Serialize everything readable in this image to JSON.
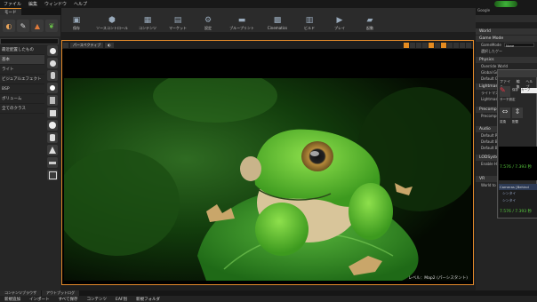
{
  "menu": {
    "items": [
      "ファイル",
      "編集",
      "ウィンドウ",
      "ヘルプ"
    ]
  },
  "tab": {
    "title": "モード"
  },
  "right_top": {
    "label": "Google"
  },
  "left_panel": {
    "categories": [
      "最近配置したもの",
      "基本",
      "ライト",
      "ビジュアルエフェクト",
      "BSP",
      "ボリューム",
      "全てのクラス"
    ],
    "mode_icons": [
      "place-mode-icon",
      "paint-mode-icon",
      "landscape-mode-icon",
      "foliage-mode-icon"
    ]
  },
  "toolbar": {
    "buttons": [
      {
        "label": "保存",
        "icon": "save-icon"
      },
      {
        "label": "ソースコントロール",
        "icon": "source-control-icon"
      },
      {
        "label": "コンテンツ",
        "icon": "content-icon"
      },
      {
        "label": "マーケット",
        "icon": "marketplace-icon"
      },
      {
        "label": "設定",
        "icon": "settings-icon"
      },
      {
        "label": "ブループリント",
        "icon": "blueprint-icon"
      },
      {
        "label": "Cinematics",
        "icon": "cinematics-icon"
      },
      {
        "label": "ビルド",
        "icon": "build-icon"
      },
      {
        "label": "プレイ",
        "icon": "play-icon"
      },
      {
        "label": "起動",
        "icon": "launch-icon"
      }
    ]
  },
  "viewport": {
    "tab": "ビューポート 1",
    "perspective": "パースペクティブ",
    "caption": "レベル：Map2 (パーシスタント)"
  },
  "details": {
    "sections": [
      {
        "title": "World",
        "rows": []
      },
      {
        "title": "Game Mode",
        "rows": [
          "GameMode",
          "選択したゲー"
        ]
      },
      {
        "title": "Physics",
        "rows": [
          "Override World",
          "Global Gravity",
          "Default Gravity"
        ]
      },
      {
        "title": "Lightmass",
        "rows": [
          "ライトマス",
          "Lightmass"
        ]
      },
      {
        "title": "Precomputed",
        "rows": [
          "Precomputed"
        ]
      },
      {
        "title": "Audio",
        "rows": [
          "Default Re",
          "Default Ba",
          "Default Ba"
        ]
      },
      {
        "title": "LODSystem",
        "rows": [
          "Enable HI"
        ]
      },
      {
        "title": "VR",
        "rows": [
          "World to"
        ]
      }
    ],
    "game_mode_value": "None",
    "stats_value_1": "7.576 / 7.393 秒",
    "stats_value_2": "7.576 / 7.393 秒"
  },
  "overlay": {
    "menu": [
      "ファイル",
      "編集",
      "ヘルプ"
    ],
    "tabs": [
      "保存",
      "カーブ"
    ],
    "buttons": [
      "サーチ設定",
      "変換",
      "配置"
    ],
    "camera_label": "Cameras",
    "camera_sub": "[Behind",
    "list_items": [
      "シンタイ",
      "シンタイ"
    ]
  },
  "bottom_tabs": [
    "コンテンツブラウザ",
    "アウトプットログ"
  ],
  "bottom_bar": [
    "新規追加",
    "インポート",
    "すべて保存",
    "コンテンツ",
    "EAF別",
    "新規フォルダ"
  ],
  "colors": {
    "accent": "#e48a2a",
    "frog_green": "#5cbd2f",
    "leaf_green": "#3a9a2a"
  }
}
